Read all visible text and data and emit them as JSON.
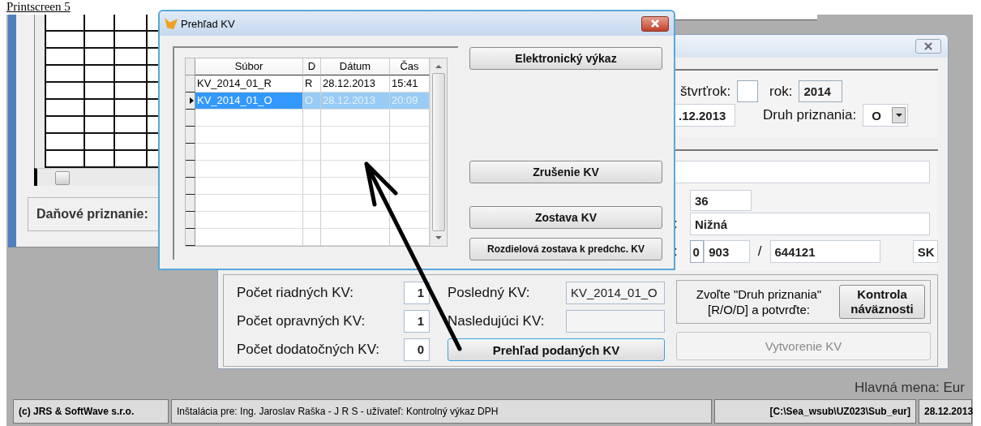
{
  "caption": "Printscreen 5",
  "background_window": {
    "label": "Daňové priznanie:"
  },
  "main_dialog": {
    "period": {
      "quarter_label": "štvrťrok:",
      "year_label": "rok:",
      "year": "2014",
      "date": ".12.2013",
      "type_label": "Druh priznania:",
      "type": "O"
    },
    "taxpayer": {
      "number": "36",
      "city_label": ":",
      "city": "Nižná",
      "phone_label": ":",
      "phone_prefix": "0",
      "phone_area": "903",
      "phone_separator": "/",
      "phone_number": "644121",
      "country": "SK"
    },
    "counts": [
      {
        "label": "Počet riadných KV:",
        "value": "1"
      },
      {
        "label": "Počet opravných KV:",
        "value": "1"
      },
      {
        "label": "Počet dodatočných KV:",
        "value": "0"
      }
    ],
    "last_label": "Posledný KV:",
    "last_value": "KV_2014_01_O",
    "next_label": "Nasledujúci KV:",
    "overview_button": "Prehľad podaných KV",
    "hint": "Zvoľte \"Druh priznania\" [R/O/D] a potvrďte:",
    "check_button": "Kontrola náväznosti",
    "create_button": {
      "label": "Vytvorenie KV",
      "disabled": true
    }
  },
  "currency": "Hlavná mena: Eur",
  "overview_dialog": {
    "title": "Prehľad KV",
    "columns": [
      "Súbor",
      "D",
      "Dátum",
      "Čas"
    ],
    "rows": [
      {
        "cells": [
          "KV_2014_01_R",
          "R",
          "28.12.2013",
          "15:41"
        ],
        "selected": false
      },
      {
        "cells": [
          "KV_2014_01_O",
          "O",
          "28.12.2013",
          "20:09"
        ],
        "selected": true
      }
    ],
    "buttons": [
      {
        "label": "Elektronický výkaz",
        "kind": "main"
      },
      {
        "label": "Zrušenie KV",
        "kind": "main"
      },
      {
        "label": "Zostava KV",
        "kind": "main"
      },
      {
        "label": "Rozdielová zostava k predchc. KV",
        "kind": "small"
      }
    ]
  },
  "status_bar": [
    "(c) JRS & SoftWave s.r.o.",
    "Inštalácia pre:  Ing. Jaroslav Raška - J R S  -  užívateľ:  Kontrolný výkaz DPH",
    "[C:\\Sea_wsub\\UZ023\\Sub_eur]",
    "28.12.2013"
  ]
}
